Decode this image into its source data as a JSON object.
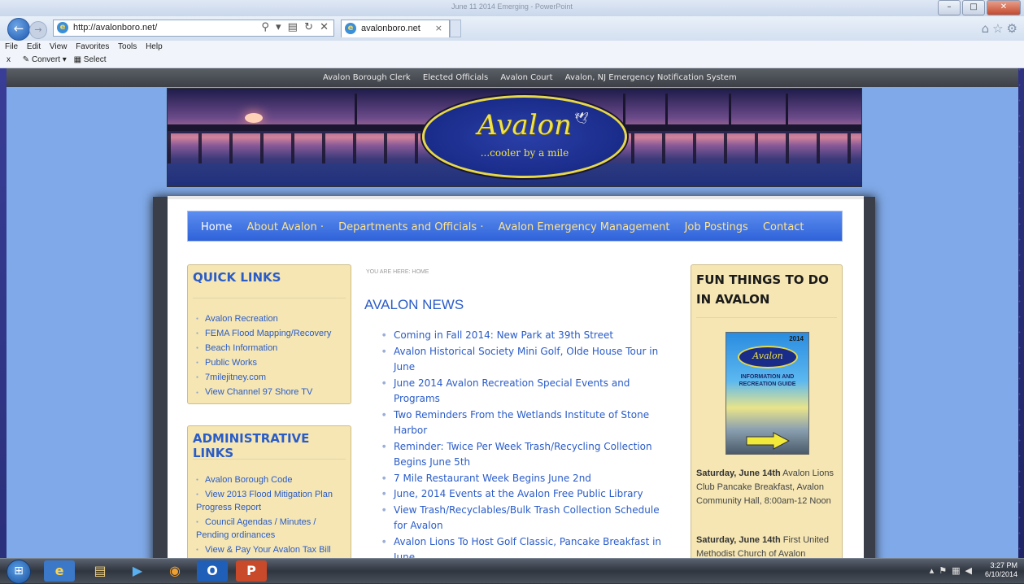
{
  "window": {
    "title": "June 11 2014 Emerging - PowerPoint"
  },
  "browser": {
    "url": "http://avalonboro.net/",
    "address_controls": "⚲ ▾ ▤ ↻ ✕",
    "tab_label": "avalonboro.net",
    "tab_close": "×",
    "menu": [
      "File",
      "Edit",
      "View",
      "Favorites",
      "Tools",
      "Help"
    ],
    "cmd_close": "x",
    "cmd_convert": "Convert",
    "cmd_select": "Select"
  },
  "site": {
    "top_links": [
      "Avalon Borough Clerk",
      "Elected Officials",
      "Avalon Court",
      "Avalon, NJ Emergency Notification System"
    ],
    "logo_brand": "Avalon",
    "logo_tagline": "...cooler by a mile",
    "nav": {
      "home": "Home",
      "about": "About Avalon ·",
      "departments": "Departments and Officials ·",
      "emergency": "Avalon Emergency Management",
      "jobs": "Job Postings",
      "contact": "Contact"
    },
    "quick_links": {
      "title": "QUICK LINKS",
      "items": [
        "Avalon Recreation",
        "FEMA Flood Mapping/Recovery",
        "Beach Information",
        "Public Works",
        "7milejitney.com",
        "View Channel 97 Shore TV"
      ]
    },
    "admin_links": {
      "title": "ADMINISTRATIVE LINKS",
      "items": [
        "Avalon Borough Code",
        "View 2013 Flood Mitigation Plan Progress Report",
        "Council Agendas / Minutes / Pending ordinances",
        "View & Pay Your Avalon Tax Bill"
      ]
    },
    "breadcrumb": "YOU ARE HERE: HOME",
    "news_title": "AVALON NEWS",
    "news": [
      "Coming in Fall 2014: New Park at 39th Street",
      "Avalon Historical Society Mini Golf, Olde House Tour in June",
      "June 2014 Avalon Recreation Special Events and Programs",
      "Two Reminders From the Wetlands Institute of Stone Harbor",
      "Reminder: Twice Per Week Trash/Recycling Collection Begins June 5th",
      "7 Mile Restaurant Week Begins June 2nd",
      "June, 2014 Events at the Avalon Free Public Library",
      "View Trash/Recyclables/Bulk Trash Collection Schedule for Avalon",
      "Avalon Lions To Host Golf Classic, Pancake Breakfast in June"
    ],
    "fun": {
      "title": "FUN THINGS TO DO IN AVALON",
      "guide_year": "2014",
      "guide_brand": "Avalon",
      "guide_title": "INFORMATION AND RECREATION GUIDE",
      "event1_date": "Saturday, June 14th",
      "event1_text": "Avalon Lions Club Pancake Breakfast, Avalon Community Hall, 8:00am-12 Noon",
      "event2_date": "Saturday, June 14th",
      "event2_text": "First United Methodist Church of Avalon"
    }
  },
  "taskbar": {
    "time": "3:27 PM",
    "date": "6/10/2014"
  }
}
